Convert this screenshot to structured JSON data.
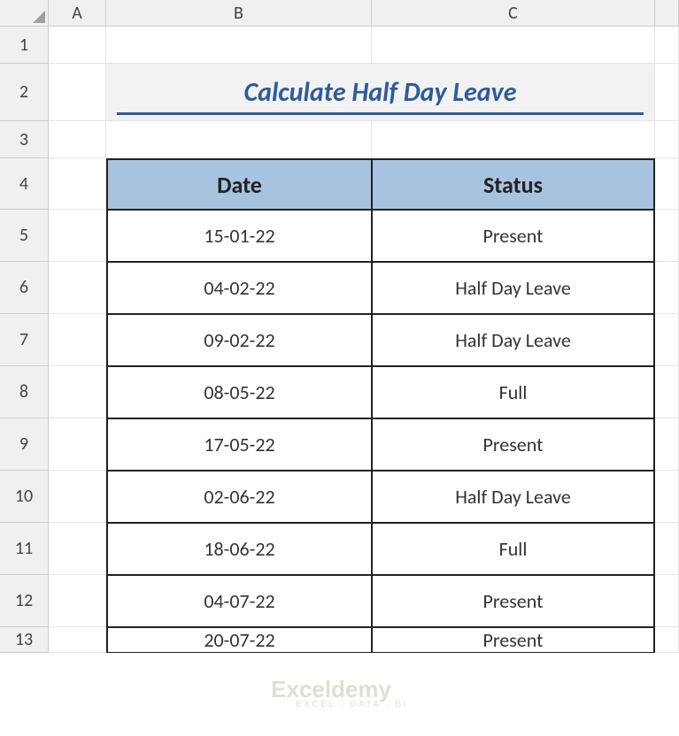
{
  "columns": [
    "A",
    "B",
    "C"
  ],
  "rows": [
    "1",
    "2",
    "3",
    "4",
    "5",
    "6",
    "7",
    "8",
    "9",
    "10",
    "11",
    "12",
    "13"
  ],
  "title": "Calculate Half Day Leave",
  "headers": {
    "date": "Date",
    "status": "Status"
  },
  "chart_data": {
    "type": "table",
    "columns": [
      "Date",
      "Status"
    ],
    "rows": [
      {
        "date": "15-01-22",
        "status": "Present"
      },
      {
        "date": "04-02-22",
        "status": "Half Day Leave"
      },
      {
        "date": "09-02-22",
        "status": "Half Day Leave"
      },
      {
        "date": "08-05-22",
        "status": "Full"
      },
      {
        "date": "17-05-22",
        "status": "Present"
      },
      {
        "date": "02-06-22",
        "status": "Half Day Leave"
      },
      {
        "date": "18-06-22",
        "status": "Full"
      },
      {
        "date": "04-07-22",
        "status": "Present"
      },
      {
        "date": "20-07-22",
        "status": "Present"
      }
    ]
  },
  "watermark": {
    "main": "Exceldemy",
    "sub": "EXCEL · DATA · BI"
  }
}
